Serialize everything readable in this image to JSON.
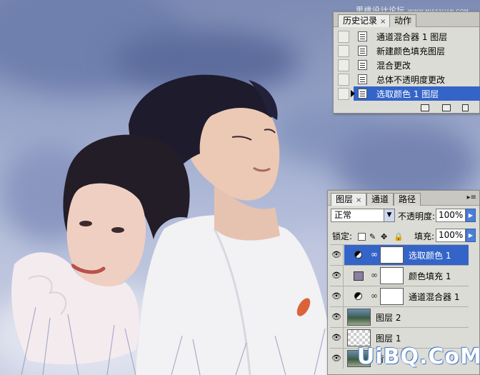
{
  "watermark_top": {
    "text": "思缘设计论坛",
    "url": "WWW.MISSYUAN.COM"
  },
  "history_panel": {
    "tabs": [
      {
        "label": "历史记录",
        "close": "×"
      },
      {
        "label": "动作"
      }
    ],
    "menu_icon": "panel-menu-icon",
    "items": [
      {
        "label": "通道混合器 1 图层",
        "selected": false
      },
      {
        "label": "新建颜色填充图层",
        "selected": false
      },
      {
        "label": "混合更改",
        "selected": false
      },
      {
        "label": "总体不透明度更改",
        "selected": false
      },
      {
        "label": "选取颜色 1 图层",
        "selected": true
      }
    ],
    "footer_icons": [
      "new-document-from-state-icon",
      "new-snapshot-icon",
      "delete-state-icon"
    ]
  },
  "layers_panel": {
    "tabs": [
      {
        "label": "图层",
        "close": "×"
      },
      {
        "label": "通道"
      },
      {
        "label": "路径"
      }
    ],
    "blend_mode": "正常",
    "opacity_label": "不透明度:",
    "opacity_value": "100%",
    "lock_label": "锁定:",
    "fill_label": "填充:",
    "fill_value": "100%",
    "layers": [
      {
        "name": "选取颜色 1",
        "kind": "adjustment",
        "selected": true
      },
      {
        "name": "颜色填充 1",
        "kind": "fill",
        "selected": false,
        "swatch_color": "#8a7fa0"
      },
      {
        "name": "通道混合器 1",
        "kind": "adjustment",
        "selected": false
      },
      {
        "name": "图层 2",
        "kind": "photo",
        "selected": false
      },
      {
        "name": "图层 1",
        "kind": "empty",
        "selected": false
      },
      {
        "name": "背",
        "kind": "photo",
        "selected": false
      }
    ]
  },
  "watermark_bottom": "UiBQ.CoM",
  "colors": {
    "selection": "#3464c8",
    "panel_bg": "#dcdcd6"
  }
}
